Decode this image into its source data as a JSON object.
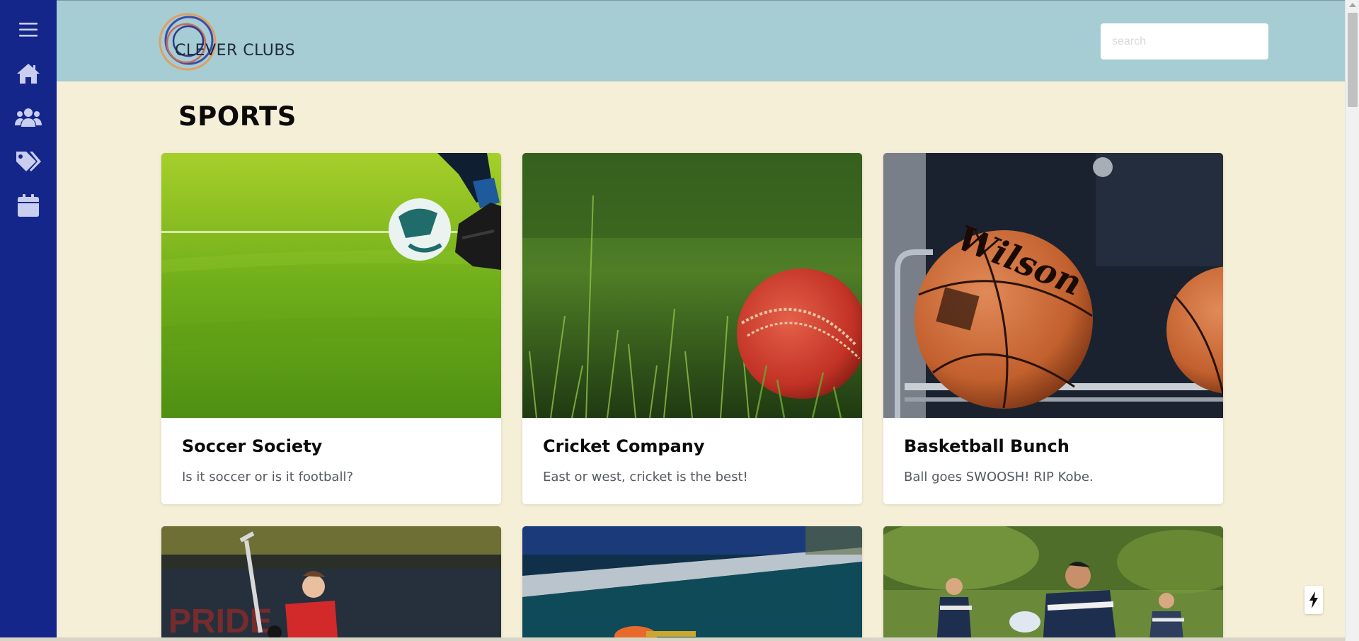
{
  "header": {
    "logo_text": "CLEVER CLUBS",
    "search_placeholder": "search"
  },
  "sidebar": {
    "items": [
      {
        "icon": "menu-icon"
      },
      {
        "icon": "home-icon"
      },
      {
        "icon": "users-icon"
      },
      {
        "icon": "tags-icon"
      },
      {
        "icon": "calendar-icon"
      }
    ]
  },
  "page": {
    "title": "SPORTS"
  },
  "cards": [
    {
      "title": "Soccer Society",
      "description": "Is it soccer or is it football?"
    },
    {
      "title": "Cricket Company",
      "description": "East or west, cricket is the best!"
    },
    {
      "title": "Basketball Bunch",
      "description": "Ball goes SWOOSH! RIP Kobe."
    }
  ],
  "colors": {
    "sidebar": "#14268a",
    "header": "#a6ccd4",
    "background": "#f6efd7"
  }
}
